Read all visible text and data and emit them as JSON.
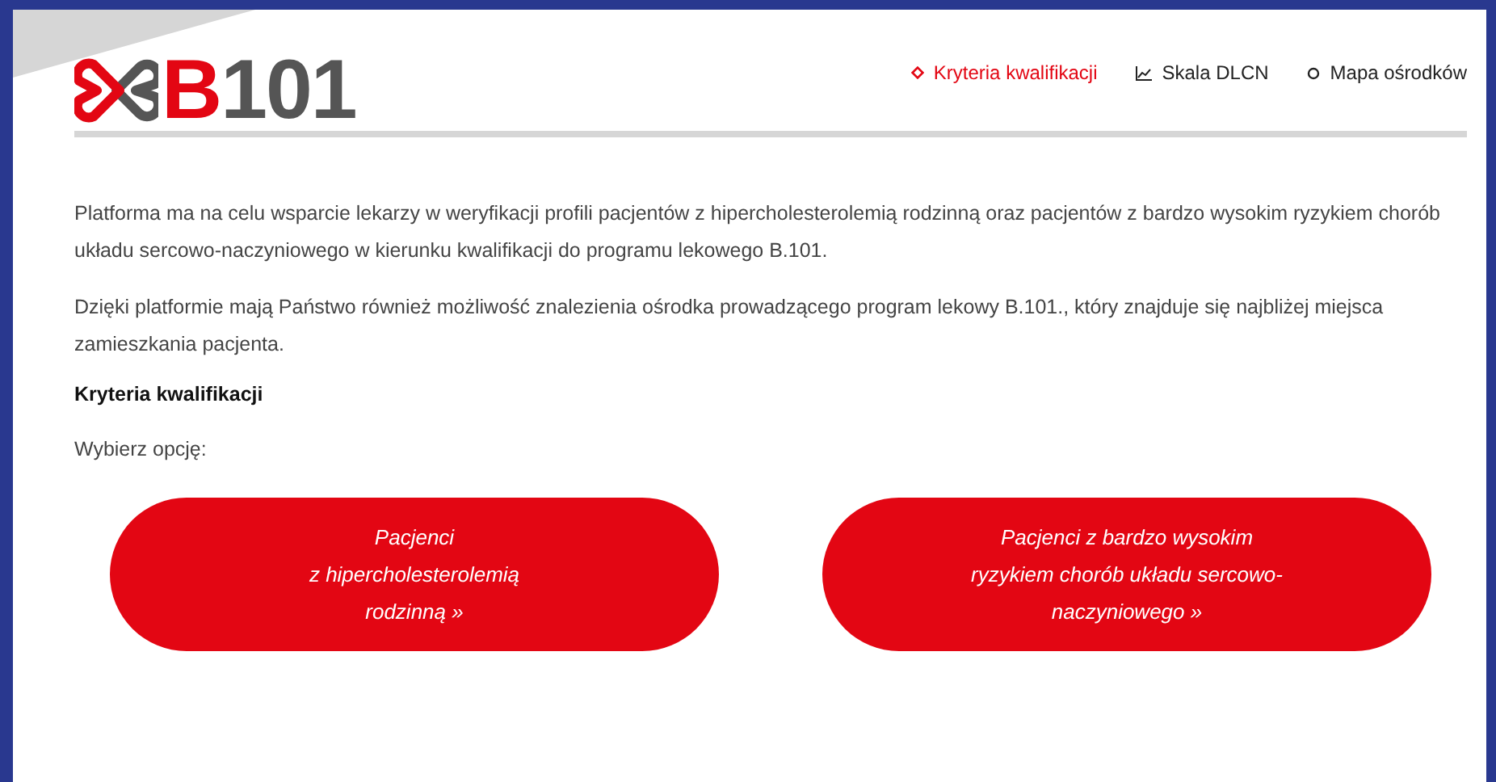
{
  "logo": [
    {
      "text": "B",
      "color": "#e30613"
    },
    {
      "text": "101",
      "color": "#555555"
    }
  ],
  "nav": [
    {
      "label": "Kryteria kwalifikacji",
      "kind": "diamond",
      "selected": true
    },
    {
      "label": "Skala DLCN",
      "kind": "chart",
      "selected": false
    },
    {
      "label": "Mapa ośrodków",
      "kind": "pin",
      "selected": false
    }
  ],
  "paragraphs": [
    "Platforma ma na celu wsparcie lekarzy w weryfikacji profili pacjentów z hipercholesterolemią rodzinną oraz pacjentów z bardzo wysokim ryzykiem chorób układu sercowo-naczyniowego w kierunku kwalifikacji do programu lekowego B.101.",
    "Dzięki platformie mają Państwo również możliwość znalezienia ośrodka prowadzącego program lekowy B.101., który znajduje się najbliżej miejsca zamieszkania pacjenta."
  ],
  "heading": "Kryteria kwalifikacji",
  "prompt": "Wybierz opcję:",
  "options": [
    {
      "lines": [
        "Pacjenci",
        "z hipercholesterolemią",
        "rodzinną »"
      ]
    },
    {
      "lines": [
        "Pacjenci z bardzo wysokim",
        "ryzykiem chorób układu sercowo-",
        "naczyniowego »"
      ]
    }
  ]
}
